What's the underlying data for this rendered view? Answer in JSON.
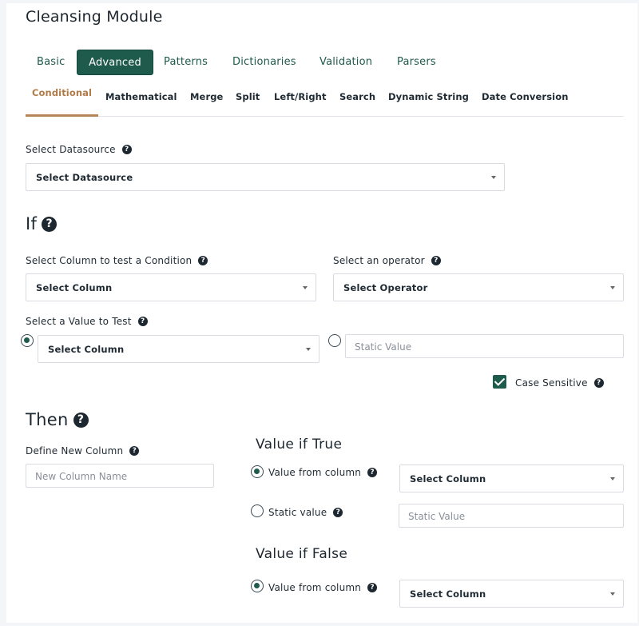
{
  "page_title": "Cleansing Module",
  "main_tabs": [
    {
      "label": "Basic"
    },
    {
      "label": "Advanced",
      "active": true
    },
    {
      "label": "Patterns"
    },
    {
      "label": "Dictionaries"
    },
    {
      "label": "Validation"
    },
    {
      "label": "Parsers"
    }
  ],
  "sub_tabs": [
    {
      "label": "Conditional",
      "active": true
    },
    {
      "label": "Mathematical"
    },
    {
      "label": "Merge"
    },
    {
      "label": "Split"
    },
    {
      "label": "Left/Right"
    },
    {
      "label": "Search"
    },
    {
      "label": "Dynamic String"
    },
    {
      "label": "Date Conversion"
    }
  ],
  "datasource": {
    "label": "Select Datasource",
    "value": "Select Datasource"
  },
  "if_section": {
    "heading": "If",
    "column_label": "Select Column to test a Condition",
    "column_value": "Select Column",
    "operator_label": "Select an operator",
    "operator_value": "Select Operator",
    "value_label": "Select a Value to Test",
    "value_column": "Select Column",
    "static_placeholder": "Static Value",
    "case_sensitive_label": "Case Sensitive",
    "case_sensitive_checked": true
  },
  "then_section": {
    "heading": "Then",
    "new_column_label": "Define New Column",
    "new_column_placeholder": "New Column Name",
    "true_heading": "Value if True",
    "true_from_column_label": "Value from column",
    "true_column_value": "Select Column",
    "true_static_label": "Static value",
    "true_static_placeholder": "Static Value",
    "false_heading": "Value if False",
    "false_from_column_label": "Value from column",
    "false_column_value": "Select Column"
  },
  "icons": {
    "help": "question-circle-icon",
    "check": "check-icon",
    "caret": "caret-down-icon"
  },
  "colors": {
    "accent": "#1e5b4c",
    "subtab_active": "#b07a49"
  }
}
